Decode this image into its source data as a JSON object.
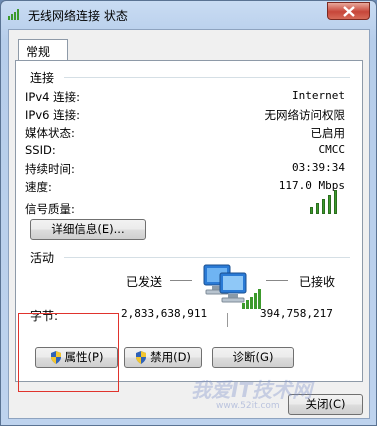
{
  "window": {
    "title": "无线网络连接 状态",
    "close_glyph": "✕"
  },
  "tabs": [
    {
      "label": "常规",
      "active": true
    }
  ],
  "connection": {
    "heading": "连接",
    "rows": [
      {
        "label": "IPv4 连接:",
        "value": "Internet"
      },
      {
        "label": "IPv6 连接:",
        "value": "无网络访问权限"
      },
      {
        "label": "媒体状态:",
        "value": "已启用"
      },
      {
        "label": "SSID:",
        "value": "CMCC"
      },
      {
        "label": "持续时间:",
        "value": "03:39:34"
      },
      {
        "label": "速度:",
        "value": "117.0 Mbps"
      }
    ],
    "signal_label": "信号质量:",
    "signal_bars_lit": 5,
    "signal_bars_total": 5,
    "details_button": "详细信息(E)..."
  },
  "activity": {
    "heading": "活动",
    "sent_label": "已发送",
    "received_label": "已接收",
    "bytes_label": "字节:",
    "bytes_sent": "2,833,638,911",
    "bytes_received": "394,758,217"
  },
  "buttons": {
    "properties": "属性(P)",
    "disable": "禁用(D)",
    "diagnose": "诊断(G)",
    "close": "关闭(C)"
  },
  "watermark": {
    "text": "我爱IT技术网",
    "url": "www.52it.com"
  },
  "colors": {
    "signal_green": "#3c9a2c",
    "highlight_red": "#e0332d"
  }
}
